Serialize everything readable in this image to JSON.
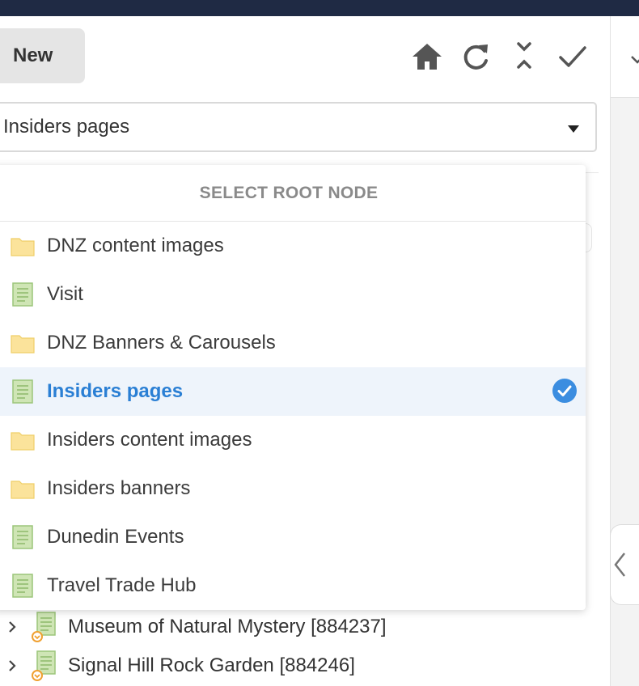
{
  "toolbar": {
    "new_label": "New",
    "icons": [
      "home-icon",
      "refresh-icon",
      "collapse-icon",
      "check-icon"
    ]
  },
  "root_select": {
    "value": "Insiders pages"
  },
  "dropdown": {
    "header": "SELECT ROOT NODE",
    "options": [
      {
        "label": "DNZ content images",
        "icon": "folder-icon",
        "selected": false
      },
      {
        "label": "Visit",
        "icon": "page-icon",
        "selected": false
      },
      {
        "label": "DNZ Banners & Carousels",
        "icon": "folder-icon",
        "selected": false
      },
      {
        "label": "Insiders pages",
        "icon": "page-icon",
        "selected": true
      },
      {
        "label": "Insiders content images",
        "icon": "folder-icon",
        "selected": false
      },
      {
        "label": "Insiders banners",
        "icon": "folder-icon",
        "selected": false
      },
      {
        "label": "Dunedin Events",
        "icon": "page-icon",
        "selected": false
      },
      {
        "label": "Travel Trade Hub",
        "icon": "page-icon",
        "selected": false
      }
    ]
  },
  "tree": {
    "items": [
      {
        "label": "Museum of Natural Mystery [884237]",
        "icon": "page-icon"
      },
      {
        "label": "Signal Hill Rock Garden [884246]",
        "icon": "page-icon"
      }
    ]
  },
  "colors": {
    "topbar": "#1f2a44",
    "accent": "#2a7fd4",
    "selected_bg": "#eef4fb",
    "folder": "#fbe39b",
    "page": "#cfe5b5",
    "badge": "#f0a030"
  }
}
